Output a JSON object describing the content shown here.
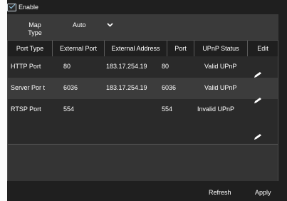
{
  "enable": {
    "label": "Enable",
    "checked": true
  },
  "map_type": {
    "label_line1": "Map",
    "label_line2": "Type",
    "value": "Auto"
  },
  "table": {
    "headers": [
      "Port Type",
      "External Port",
      "External Address",
      "Port",
      "UPnP Status",
      "Edit"
    ],
    "rows": [
      {
        "port_type": "HTTP Port",
        "external_port": "80",
        "external_address": "183.17.254.19",
        "port": "80",
        "status": "Valid UPnP"
      },
      {
        "port_type": "Server Por t",
        "external_port": "6036",
        "external_address": "183.17.254.19",
        "port": "6036",
        "status": "Valid UPnP"
      },
      {
        "port_type": "RTSP Port",
        "external_port": "554",
        "external_address": "",
        "port": "554",
        "status": "Invalid UPnP"
      }
    ]
  },
  "footer": {
    "refresh_label": "Refresh",
    "apply_label": "Apply"
  },
  "icons": {
    "edit": "pencil-icon",
    "dropdown": "chevron-down-icon",
    "checkbox": "checkbox-checked-icon"
  }
}
